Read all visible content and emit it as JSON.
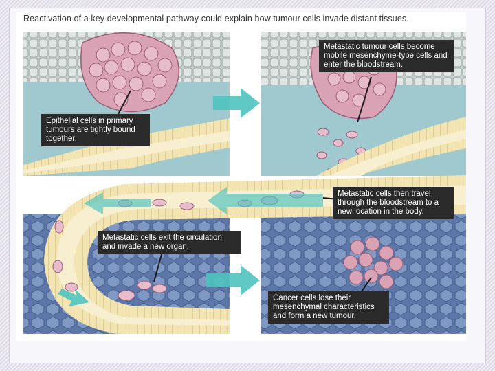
{
  "figure": {
    "title": "Reactivation of a key developmental pathway could explain how tumour cells invade distant tissues."
  },
  "callouts": {
    "epithelial": "Epithelial cells in primary tumours are tightly bound together.",
    "metastatic_become": "Metastatic tumour cells become mobile mesenchyme-type cells and enter the bloodstream.",
    "travel": "Metastatic cells then travel through the bloodstream to a new location in the body.",
    "exit": "Metastatic cells exit the circulation and invade a new organ.",
    "lose": "Cancer cells lose their mesenchymal characteristics and form a new tumour."
  },
  "colors": {
    "epithelium": "#c8d0cd",
    "stroma": "#9fc9cf",
    "organ": "#5d78a8",
    "vessel_wall": "#f2e4b3",
    "vessel_lumen": "#f7efcf",
    "tumour_cell": "#d9a3b5",
    "arrow": "#4fc3bf",
    "callout": "#2a2a2a"
  }
}
